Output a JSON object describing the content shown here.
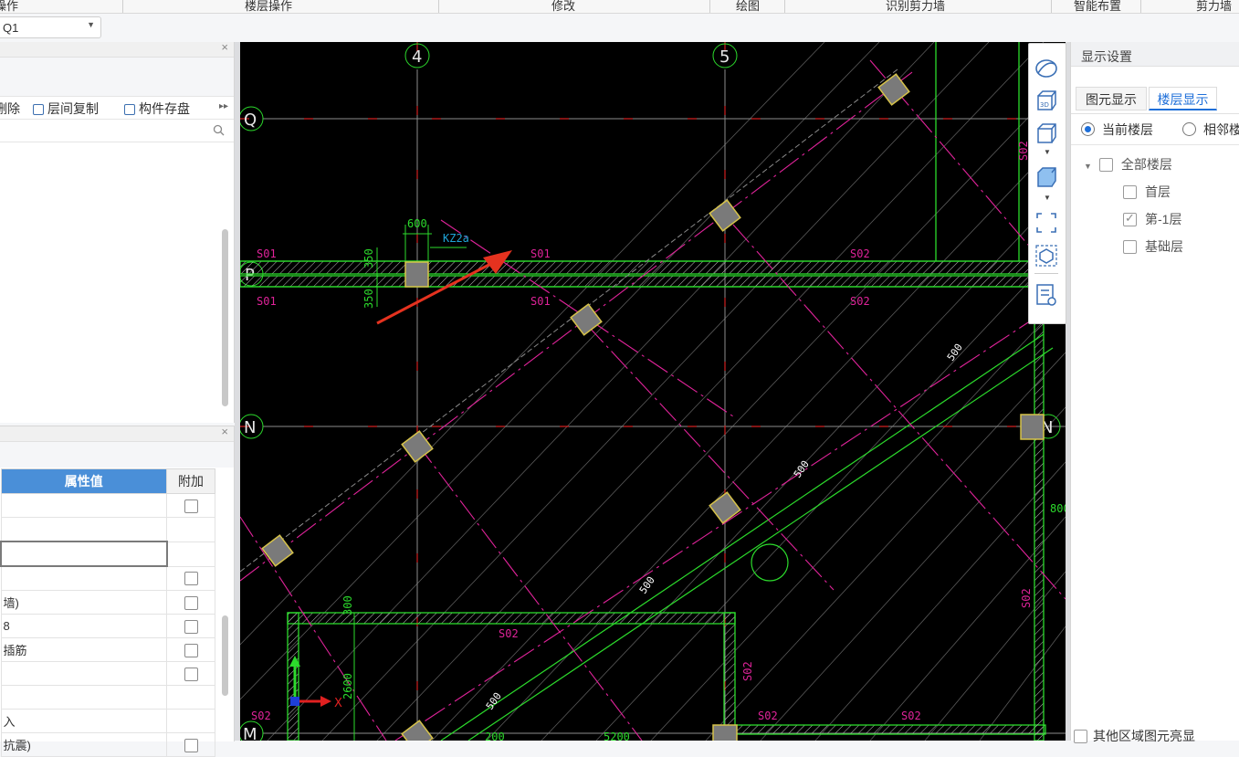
{
  "top_tabs": [
    "操作",
    "楼层操作",
    "修改",
    "绘图",
    "识别剪力墙",
    "智能布置",
    "剪力墙"
  ],
  "floor_select": {
    "value": "Q1"
  },
  "component_toolbar": {
    "delete": "删除",
    "floor_copy": "层间复制",
    "save": "构件存盘"
  },
  "properties": {
    "col_value": "属性值",
    "col_add": "附加",
    "rows": [
      "",
      "",
      "",
      "",
      "墙)",
      "8",
      "插筋",
      "",
      "",
      "入",
      "抗震)"
    ]
  },
  "canvas": {
    "axes_vertical": [
      "4",
      "5"
    ],
    "axes_horizontal": [
      "Q",
      "P",
      "N",
      "M"
    ],
    "labels": {
      "s01": "S01",
      "s02": "S02",
      "kz": "KZ2a",
      "d600": "600",
      "d350": "350",
      "d500": "500",
      "d300": "300",
      "d2600": "2600",
      "d200": "200",
      "d5200": "5200",
      "d800": "800",
      "x": "X",
      "y": "Y"
    }
  },
  "right_panel": {
    "title": "显示设置",
    "tabs": [
      "图元显示",
      "楼层显示"
    ],
    "radio_current": "当前楼层",
    "radio_adjacent": "相邻楼",
    "tree": {
      "all": "全部楼层",
      "first": "首层",
      "minus1": "第-1层",
      "foundation": "基础层"
    },
    "bottom": "其他区域图元亮显"
  },
  "colors": {
    "accent": "#1e6fd9",
    "header_blue": "#4a8fd8",
    "cad_bg": "#000000",
    "wall_green": "#2cdb2c",
    "magenta": "#e0239a"
  }
}
